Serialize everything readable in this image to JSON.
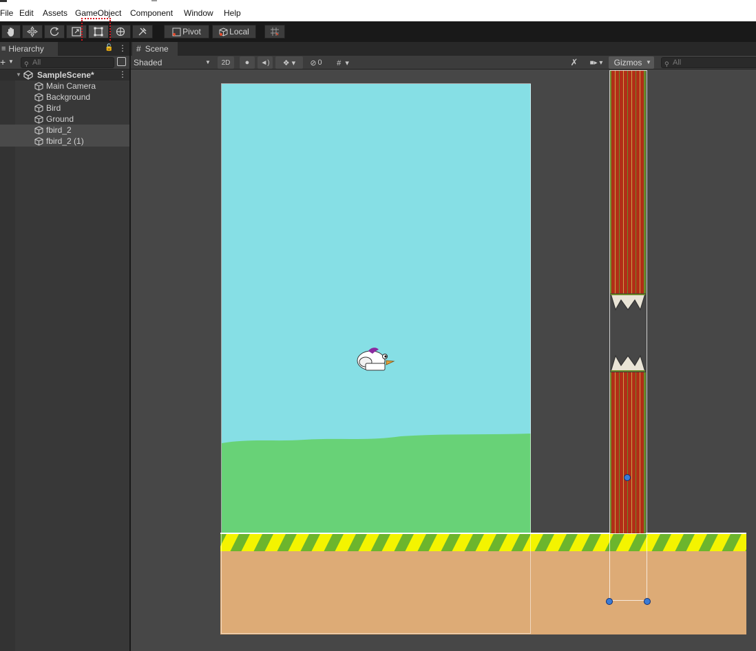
{
  "menu": {
    "items": [
      "File",
      "Edit",
      "Assets",
      "GameObject",
      "Component",
      "Window",
      "Help"
    ]
  },
  "toolbar": {
    "tools": [
      "hand-tool",
      "move-tool",
      "rotate-tool",
      "scale-tool",
      "rect-tool",
      "transform-tool",
      "custom-editor-tool"
    ],
    "active_tool": "rect-tool",
    "pivot_label": "Pivot",
    "local_label": "Local"
  },
  "hierarchy": {
    "tab_label": "Hierarchy",
    "search_placeholder": "All",
    "scene_name": "SampleScene*",
    "items": [
      {
        "label": "Main Camera",
        "selected": false
      },
      {
        "label": "Background",
        "selected": false
      },
      {
        "label": "Bird",
        "selected": false
      },
      {
        "label": "Ground",
        "selected": false
      },
      {
        "label": "fbird_2",
        "selected": true
      },
      {
        "label": "fbird_2 (1)",
        "selected": true
      }
    ]
  },
  "scene": {
    "tab_label": "Scene",
    "draw_mode": "Shaded",
    "mode_2d": "2D",
    "hidden_count": "0",
    "gizmos_label": "Gizmos",
    "search_placeholder": "All"
  },
  "colors": {
    "sky": "#86dfe5",
    "grass": "#68d277",
    "dirt": "#ddab76",
    "stripe_yellow": "#f4f400",
    "stripe_green": "#6cb52d",
    "pipe_red": "#b22d17",
    "selection_outline": "#d9141c"
  }
}
